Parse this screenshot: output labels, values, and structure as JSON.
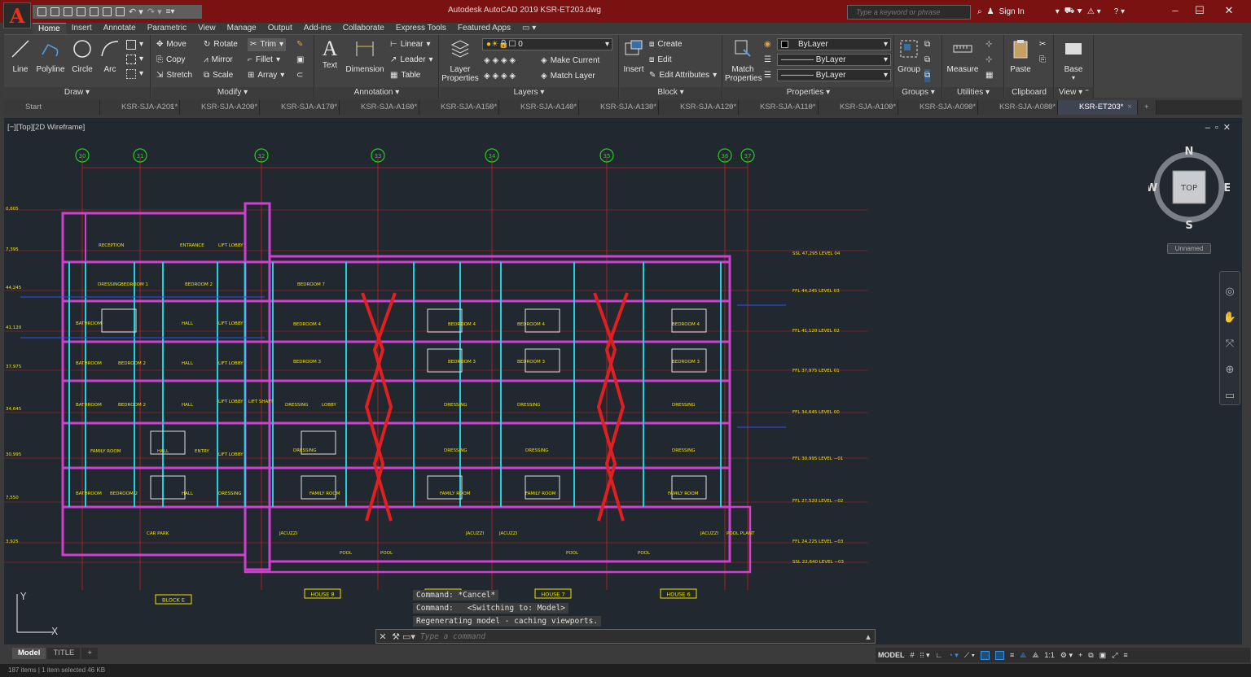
{
  "app": {
    "title": "Autodesk AutoCAD 2019    KSR-ET203.dwg",
    "logo": "A",
    "search_placeholder": "Type a keyword or phrase",
    "sign_in": "Sign In"
  },
  "ribbon_tabs": [
    "Home",
    "Insert",
    "Annotate",
    "Parametric",
    "View",
    "Manage",
    "Output",
    "Add-ins",
    "Collaborate",
    "Express Tools",
    "Featured Apps"
  ],
  "ribbon": {
    "draw": {
      "title": "Draw",
      "line": "Line",
      "polyline": "Polyline",
      "circle": "Circle",
      "arc": "Arc"
    },
    "modify": {
      "title": "Modify",
      "move": "Move",
      "rotate": "Rotate",
      "trim": "Trim",
      "copy": "Copy",
      "mirror": "Mirror",
      "fillet": "Fillet",
      "stretch": "Stretch",
      "scale": "Scale",
      "array": "Array"
    },
    "annotation": {
      "title": "Annotation",
      "text": "Text",
      "dimension": "Dimension",
      "linear": "Linear",
      "leader": "Leader",
      "table": "Table"
    },
    "layers": {
      "title": "Layers",
      "layer_properties": "Layer Properties",
      "current_layer": "0",
      "make_current": "Make Current",
      "match_layer": "Match Layer"
    },
    "block": {
      "title": "Block",
      "insert": "Insert",
      "create": "Create",
      "edit": "Edit",
      "edit_attributes": "Edit Attributes"
    },
    "properties": {
      "title": "Properties",
      "match_properties": "Match Properties",
      "color": "ByLayer",
      "linetype": "ByLayer",
      "lineweight": "ByLayer"
    },
    "groups": {
      "title": "Groups",
      "group": "Group"
    },
    "utilities": {
      "title": "Utilities",
      "measure": "Measure"
    },
    "clipboard": {
      "title": "Clipboard",
      "paste": "Paste"
    },
    "view": {
      "title": "View",
      "base": "Base"
    }
  },
  "doc_tabs": [
    "Start",
    "KSR-SJA-A201*",
    "KSR-SJA-A200*",
    "KSR-SJA-A170*",
    "KSR-SJA-A160*",
    "KSR-SJA-A150*",
    "KSR-SJA-A140*",
    "KSR-SJA-A130*",
    "KSR-SJA-A120*",
    "KSR-SJA-A110*",
    "KSR-SJA-A100*",
    "KSR-SJA-A090*",
    "KSR-SJA-A080*",
    "KSR-ET203*"
  ],
  "viewport": {
    "label": "[−][Top][2D Wireframe]",
    "viewcube": {
      "n": "N",
      "s": "S",
      "e": "E",
      "w": "W",
      "face": "TOP"
    },
    "ucs_name": "Unnamed",
    "ucs_x": "X",
    "ucs_y": "Y"
  },
  "drawing": {
    "grid_labels": [
      "30",
      "31",
      "32",
      "33",
      "34",
      "35",
      "36",
      "37"
    ],
    "level_left": [
      "0,605",
      "7,395",
      "44,245",
      "41,120",
      "37,975",
      "34,645",
      "30,995",
      "7,550",
      "3,925"
    ],
    "level_right": [
      "SSL 47,295  LEVEL 04",
      "FFL 44,245  LEVEL 03",
      "FFL 41,120  LEVEL 02",
      "FFL 37,975  LEVEL 01",
      "FFL 34,645  LEVEL 00",
      "FFL 30,995  LEVEL −01",
      "FFL 27,520  LEVEL −02",
      "FFL 24,225  LEVEL −03",
      "SSL 22,640  LEVEL −03"
    ],
    "room_labels": [
      "RECEPTION",
      "ENTRANCE",
      "LIFT LOBBY",
      "DRESSING",
      "BEDROOM 1",
      "BEDROOM 2",
      "BATHROOM",
      "HALL",
      "FAMILY ROOM",
      "ENTRY",
      "CAR PARK",
      "JACUZZI",
      "POOL",
      "POOL PLANT",
      "LIFT SHAFT",
      "LOBBY",
      "BEDROOM 4",
      "BEDROOM 3",
      "BEDROOM 7"
    ],
    "house_tags": [
      "BLOCK E",
      "HOUSE 8",
      "HOUSE 9",
      "HOUSE 7",
      "HOUSE 6"
    ]
  },
  "command": {
    "history": [
      "Command: *Cancel*",
      "Command:   <Switching to: Model>",
      "Regenerating model - caching viewports."
    ],
    "placeholder": "Type a command"
  },
  "layout_tabs": [
    "Model",
    "TITLE"
  ],
  "status": {
    "model": "MODEL",
    "scale": "1:1"
  },
  "bottom": "187 items  |  1 item selected  46 KB"
}
